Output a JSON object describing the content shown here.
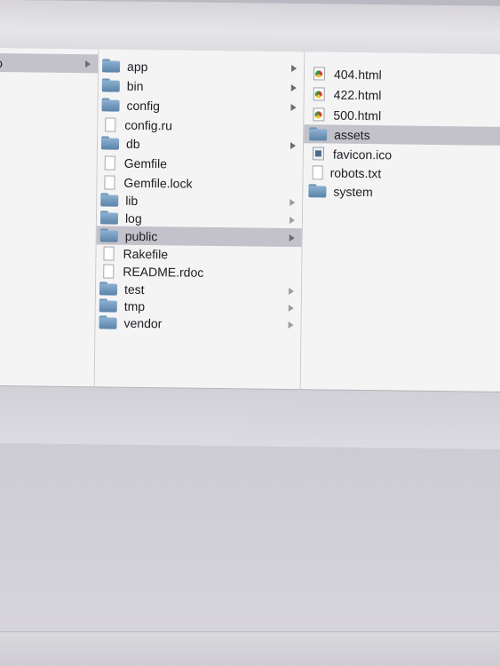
{
  "column1": {
    "selected_label": "o"
  },
  "column2": {
    "items": [
      {
        "label": "app",
        "kind": "folder",
        "icon": "folder-icon",
        "arrow": true
      },
      {
        "label": "bin",
        "kind": "folder",
        "icon": "folder-icon",
        "arrow": true
      },
      {
        "label": "config",
        "kind": "folder",
        "icon": "folder-icon",
        "arrow": true
      },
      {
        "label": "config.ru",
        "kind": "file",
        "icon": "document-icon",
        "arrow": false
      },
      {
        "label": "db",
        "kind": "folder",
        "icon": "folder-icon",
        "arrow": true
      },
      {
        "label": "Gemfile",
        "kind": "file",
        "icon": "document-icon",
        "arrow": false
      },
      {
        "label": "Gemfile.lock",
        "kind": "file",
        "icon": "document-icon",
        "arrow": false
      },
      {
        "label": "lib",
        "kind": "folder",
        "icon": "folder-icon",
        "arrow": true
      },
      {
        "label": "log",
        "kind": "folder",
        "icon": "folder-icon",
        "arrow": true
      },
      {
        "label": "public",
        "kind": "folder",
        "icon": "folder-icon",
        "arrow": true,
        "selected": true
      },
      {
        "label": "Rakefile",
        "kind": "file",
        "icon": "document-icon",
        "arrow": false
      },
      {
        "label": "README.rdoc",
        "kind": "file",
        "icon": "document-icon",
        "arrow": false
      },
      {
        "label": "test",
        "kind": "folder",
        "icon": "folder-icon",
        "arrow": true
      },
      {
        "label": "tmp",
        "kind": "folder",
        "icon": "folder-icon",
        "arrow": true
      },
      {
        "label": "vendor",
        "kind": "folder",
        "icon": "folder-icon",
        "arrow": true
      }
    ]
  },
  "column3": {
    "items": [
      {
        "label": "404.html",
        "kind": "html",
        "icon": "html-file-icon"
      },
      {
        "label": "422.html",
        "kind": "html",
        "icon": "html-file-icon"
      },
      {
        "label": "500.html",
        "kind": "html",
        "icon": "html-file-icon"
      },
      {
        "label": "assets",
        "kind": "folder",
        "icon": "folder-icon",
        "selected": true
      },
      {
        "label": "favicon.ico",
        "kind": "ico",
        "icon": "ico-file-icon"
      },
      {
        "label": "robots.txt",
        "kind": "file",
        "icon": "document-icon"
      },
      {
        "label": "system",
        "kind": "folder",
        "icon": "folder-icon"
      }
    ]
  },
  "colors": {
    "selection": "#c3c2ca",
    "folder": "#6f95b8"
  }
}
